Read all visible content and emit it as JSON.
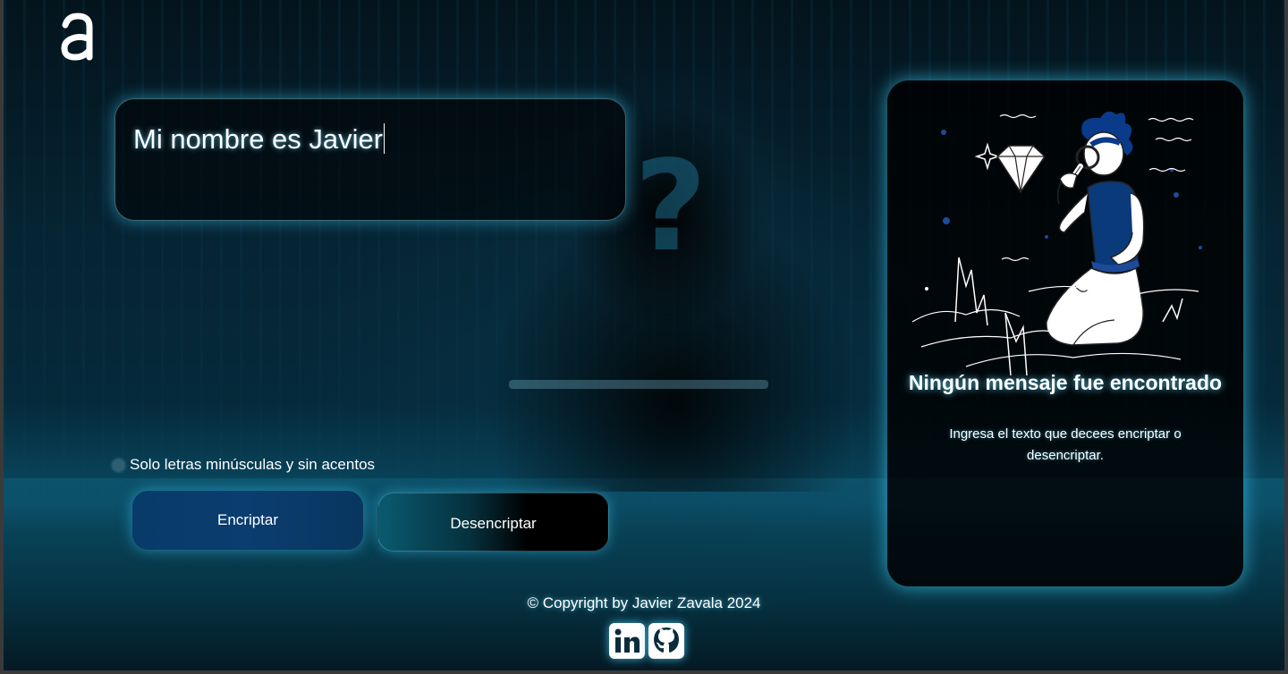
{
  "input": {
    "value": "Mi nombre es Javier"
  },
  "hint": {
    "text": "Solo letras minúsculas y sin acentos"
  },
  "buttons": {
    "encrypt_label": "Encriptar",
    "decrypt_label": "Desencriptar"
  },
  "result": {
    "title": "Ningún mensaje fue encontrado",
    "subtitle": "Ingresa el texto que decees encriptar o desencriptar."
  },
  "footer": {
    "copyright": "© Copyright by Javier Zavala 2024"
  },
  "social": {
    "linkedin_icon": "linkedin-icon",
    "github_icon": "github-icon"
  },
  "colors": {
    "glow": "#3cc8f0",
    "encrypt_button": "#0b3d70",
    "accent_blue": "#0a3a7a"
  }
}
